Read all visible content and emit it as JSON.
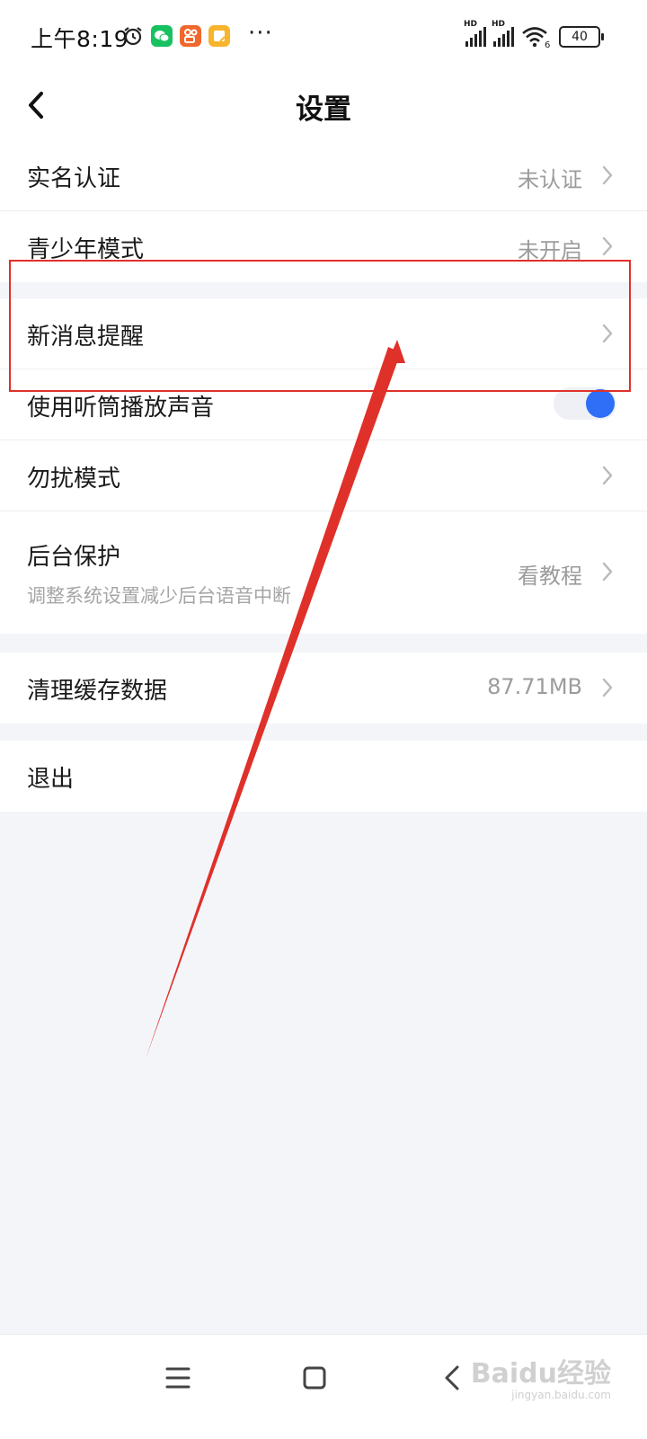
{
  "status_bar": {
    "time": "上午8:19",
    "more": "···",
    "battery": "40",
    "signal_1_label": "HD",
    "signal_2_label": "HD",
    "wifi_badge": "6",
    "app_colors": [
      "#17c160",
      "#f0682b",
      "#f7b52d"
    ]
  },
  "header": {
    "title": "设置"
  },
  "groups": [
    {
      "items": [
        {
          "label": "实名认证",
          "value": "未认证"
        },
        {
          "label": "青少年模式",
          "value": "未开启"
        }
      ]
    },
    {
      "items": [
        {
          "label": "新消息提醒"
        },
        {
          "label": "使用听筒播放声音",
          "toggle_on": true
        },
        {
          "label": "勿扰模式"
        },
        {
          "label": "后台保护",
          "subtitle": "调整系统设置减少后台语音中断",
          "value": "看教程"
        }
      ]
    },
    {
      "items": [
        {
          "label": "清理缓存数据",
          "value": "87.71MB"
        }
      ]
    },
    {
      "items": [
        {
          "label": "退出"
        }
      ]
    }
  ],
  "colors": {
    "accent": "#2f6ef6",
    "annotation": "#e0302a",
    "background": "#f4f5f9"
  },
  "watermark": {
    "text": "Baidu经验",
    "sub": "jingyan.baidu.com"
  }
}
